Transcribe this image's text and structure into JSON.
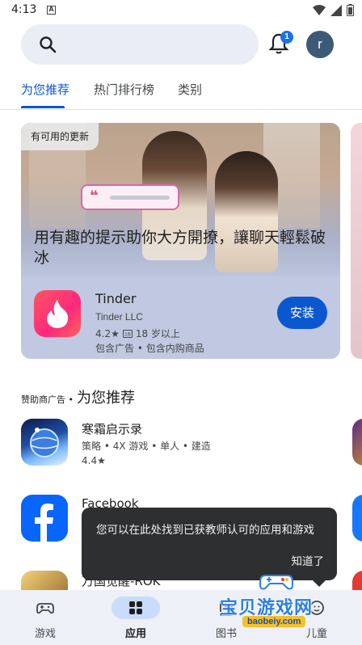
{
  "status_bar": {
    "time": "4:13",
    "notification_glyph": "A"
  },
  "search": {
    "placeholder": "",
    "notification_count": "1",
    "avatar_letter": "r"
  },
  "tabs": [
    {
      "label": "为您推荐",
      "active": true
    },
    {
      "label": "热门排行榜",
      "active": false
    },
    {
      "label": "类别",
      "active": false
    }
  ],
  "promo": {
    "badge": "有可用的更新",
    "headline": "用有趣的提示助你大方開撩，讓聊天輕鬆破冰",
    "app": {
      "name": "Tinder",
      "developer": "Tinder LLC",
      "rating": "4.2★",
      "age": "18 岁以上",
      "ads": "包含广告 • 包含内购商品",
      "install_label": "安装"
    }
  },
  "section": {
    "sponsored": "赞助商广告 •",
    "title": "为您推荐"
  },
  "apps": [
    {
      "name": "寒霜启示录",
      "tags": "策略 • 4X 游戏 • 单人 • 建造",
      "rating": "4.4★"
    },
    {
      "name": "Facebook",
      "tags": "",
      "rating": ""
    },
    {
      "name": "万国觉醒-ROK",
      "tags": "",
      "rating": ""
    }
  ],
  "tooltip": {
    "text": "您可以在此处找到已获教师认可的应用和游戏",
    "action": "知道了"
  },
  "bottom_nav": [
    {
      "label": "游戏",
      "icon": "gamepad-icon",
      "active": false
    },
    {
      "label": "应用",
      "icon": "apps-grid-icon",
      "active": true
    },
    {
      "label": "图书",
      "icon": "book-icon",
      "active": false
    },
    {
      "label": "儿童",
      "icon": "kids-icon",
      "active": false
    }
  ],
  "watermark": {
    "text": "宝贝游戏网",
    "url": "baobeiy.com"
  },
  "colors": {
    "accent": "#0b57d0",
    "tinder": "#fd297b",
    "tooltip_bg": "#2e2f30"
  }
}
